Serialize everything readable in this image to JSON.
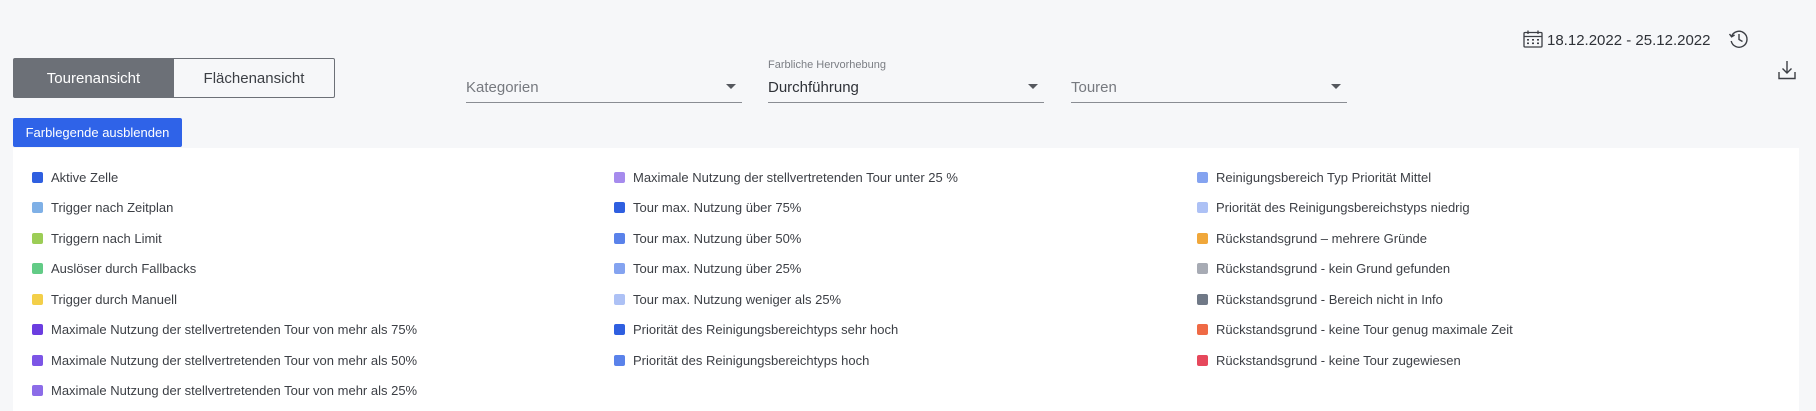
{
  "header": {
    "date_range": "18.12.2022 - 25.12.2022",
    "calendar_icon": "calendar-icon",
    "history_icon": "history-icon",
    "download_icon": "download-icon"
  },
  "view_toggle": {
    "tour_view": "Tourenansicht",
    "area_view": "Flächenansicht",
    "active": "tour_view"
  },
  "filters": {
    "categories": {
      "label": "",
      "value": "Kategorien"
    },
    "highlight": {
      "label": "Farbliche Hervorhebung",
      "value": "Durchführung"
    },
    "tours": {
      "label": "",
      "value": "Touren"
    }
  },
  "legend_toggle": {
    "label": "Farblegende ausblenden"
  },
  "legend": {
    "columns": [
      [
        {
          "label": "Aktive Zelle",
          "color": "#2f5fe0"
        },
        {
          "label": "Trigger nach Zeitplan",
          "color": "#7fb0e6"
        },
        {
          "label": "Triggern nach Limit",
          "color": "#9ccd56"
        },
        {
          "label": "Auslöser durch Fallbacks",
          "color": "#62cb86"
        },
        {
          "label": "Trigger durch Manuell",
          "color": "#f3cf49"
        },
        {
          "label": "Maximale Nutzung der stellvertretenden Tour von mehr als 75%",
          "color": "#6b3de0"
        },
        {
          "label": "Maximale Nutzung der stellvertretenden Tour von mehr als 50%",
          "color": "#7c55e6"
        },
        {
          "label": "Maximale Nutzung der stellvertretenden Tour von mehr als 25%",
          "color": "#8c6ce8"
        }
      ],
      [
        {
          "label": "Maximale Nutzung der stellvertretenden Tour unter 25 %",
          "color": "#a68bed"
        },
        {
          "label": "Tour max. Nutzung über 75%",
          "color": "#2f5fe0"
        },
        {
          "label": "Tour max. Nutzung über 50%",
          "color": "#5a82ea"
        },
        {
          "label": "Tour max. Nutzung über 25%",
          "color": "#84a3f0"
        },
        {
          "label": "Tour max. Nutzung weniger als 25%",
          "color": "#adc1f5"
        },
        {
          "label": "Priorität des Reinigungsbereichtyps sehr hoch",
          "color": "#2f5fe0"
        },
        {
          "label": "Priorität des Reinigungsbereichtyps hoch",
          "color": "#5a82ea"
        }
      ],
      [
        {
          "label": "Reinigungsbereich Typ Priorität Mittel",
          "color": "#84a3f0"
        },
        {
          "label": "Priorität des Reinigungsbereichstyps niedrig",
          "color": "#adc1f5"
        },
        {
          "label": "Rückstandsgrund – mehrere Gründe",
          "color": "#f0a73a"
        },
        {
          "label": "Rückstandsgrund - kein Grund gefunden",
          "color": "#a7abb4"
        },
        {
          "label": "Rückstandsgrund - Bereich nicht in Info",
          "color": "#707987"
        },
        {
          "label": "Rückstandsgrund - keine Tour genug maximale Zeit",
          "color": "#ef6a45"
        },
        {
          "label": "Rückstandsgrund - keine Tour zugewiesen",
          "color": "#e6485c"
        }
      ]
    ]
  }
}
